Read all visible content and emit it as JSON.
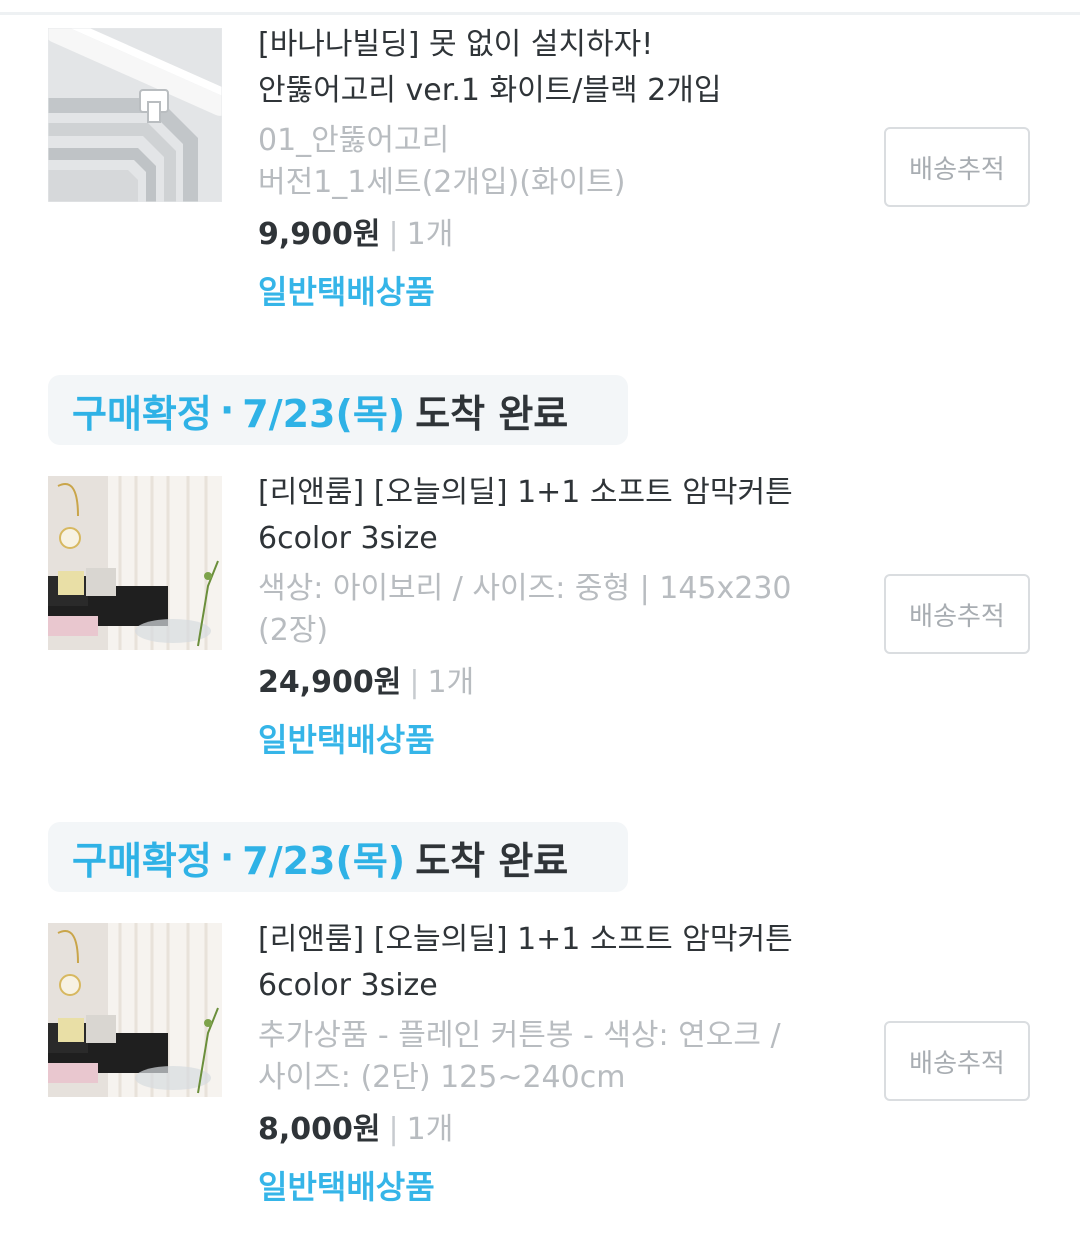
{
  "status_groups": [
    {
      "accent": "구매확정",
      "dot": "·",
      "date": "7/23(목)",
      "status": "도착 완료"
    },
    {
      "accent": "구매확정",
      "dot": "·",
      "date": "7/23(목)",
      "status": "도착 완료"
    }
  ],
  "items": [
    {
      "title_line1": "[바나나빌딩] 못 없이 설치하자!",
      "title_line2": "안뚫어고리 ver.1 화이트/블랙 2개입",
      "option_line1": "01_안뚫어고리",
      "option_line2": "버전1_1세트(2개입)(화이트)",
      "price": "9,900원",
      "separator": "|",
      "quantity": "1개",
      "shipping_type": "일반택배상품",
      "track_button": "배송추적",
      "thumbnail_icon": "curtain-rod-product-image"
    },
    {
      "title_line1": "[리앤룸] [오늘의딜] 1+1 소프트 암막커튼",
      "title_line2": "6color 3size",
      "option_line1": "색상: 아이보리 / 사이즈: 중형 | 145x230",
      "option_line2": "(2장)",
      "price": "24,900원",
      "separator": "|",
      "quantity": "1개",
      "shipping_type": "일반택배상품",
      "track_button": "배송추적",
      "thumbnail_icon": "curtain-room-product-image"
    },
    {
      "title_line1": "[리앤룸] [오늘의딜] 1+1 소프트 암막커튼",
      "title_line2": "6color 3size",
      "option_line1": "추가상품 - 플레인 커튼봉 - 색상: 연오크 /",
      "option_line2": "사이즈: (2단) 125~240cm",
      "price": "8,000원",
      "separator": "|",
      "quantity": "1개",
      "shipping_type": "일반택배상품",
      "track_button": "배송추적",
      "thumbnail_icon": "curtain-room-product-image"
    }
  ],
  "colors": {
    "accent_blue": "#2fb2e6",
    "shipping_blue": "#35b5e8",
    "text_dark": "#2f3438",
    "text_muted": "#b8bcc0"
  }
}
